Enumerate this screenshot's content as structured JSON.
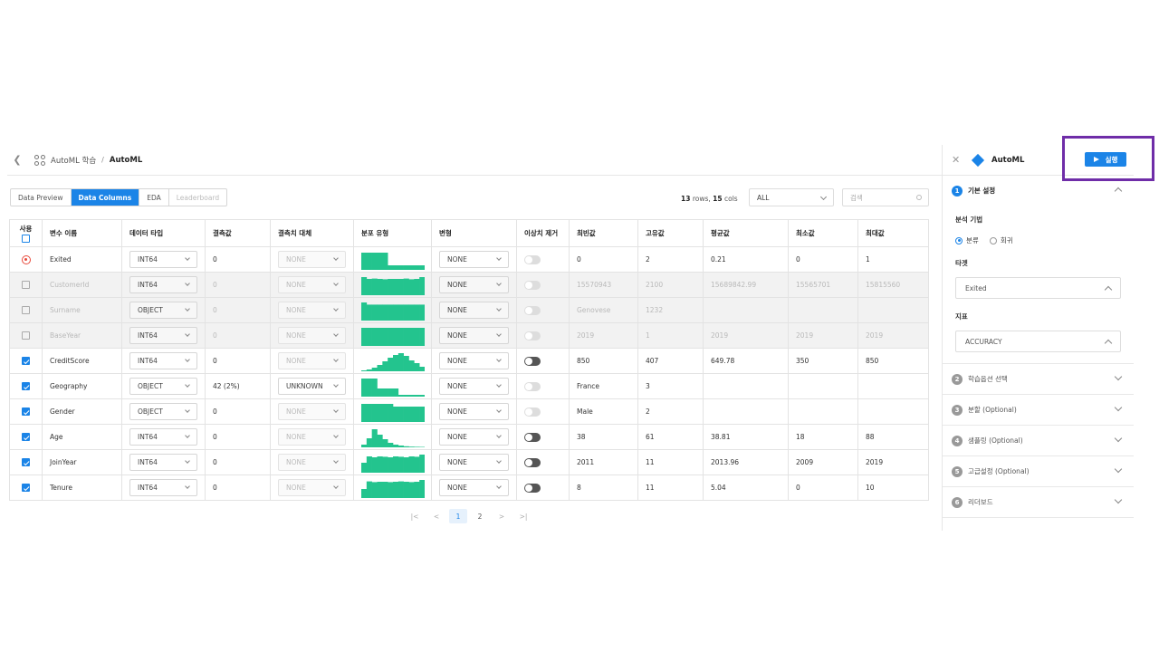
{
  "header": {
    "crumb1": "AutoML 학습",
    "sep": "/",
    "crumb2": "AutoML"
  },
  "tabs": [
    "Data Preview",
    "Data Columns",
    "EDA",
    "Leaderboard"
  ],
  "toolbar": {
    "rows": "13",
    "rows_label": "rows,",
    "cols": "15",
    "cols_label": "cols",
    "filter_value": "ALL",
    "search_placeholder": "검색"
  },
  "table": {
    "headers": [
      "사용",
      "변수 이름",
      "데이터 타입",
      "결측값",
      "결측치 대체",
      "분포 유형",
      "변형",
      "이상치 제거",
      "최빈값",
      "고유값",
      "평균값",
      "최소값",
      "최대값"
    ],
    "rows": [
      {
        "use": "target",
        "name": "Exited",
        "type": "INT64",
        "missing": "0",
        "impute": "NONE",
        "hist": [
          0.95,
          0.95,
          0.95,
          0.95,
          0.95,
          0.25,
          0.25,
          0.25,
          0.25,
          0.25,
          0.25,
          0.25
        ],
        "transform": "NONE",
        "outlier": "off",
        "mode": "0",
        "unique": "2",
        "mean": "0.21",
        "min": "0",
        "max": "1",
        "dim": false
      },
      {
        "use": "unchecked",
        "name": "CustomerId",
        "type": "INT64",
        "missing": "0",
        "impute": "NONE",
        "hist": [
          1,
          0.9,
          0.92,
          0.9,
          0.88,
          0.9,
          0.9,
          0.9,
          0.92,
          0.88,
          0.9,
          1
        ],
        "transform": "NONE",
        "outlier": "off",
        "mode": "15570943",
        "unique": "2100",
        "mean": "15689842.99",
        "min": "15565701",
        "max": "15815560",
        "dim": true
      },
      {
        "use": "unchecked",
        "name": "Surname",
        "type": "OBJECT",
        "missing": "0",
        "impute": "NONE",
        "hist": [
          1,
          0.88,
          0.88,
          0.88,
          0.88,
          0.88,
          0.88,
          0.88,
          0.88,
          0.88,
          0.88,
          0.88
        ],
        "transform": "NONE",
        "outlier": "dis",
        "mode": "Genovese",
        "unique": "1232",
        "mean": "",
        "min": "",
        "max": "",
        "dim": true
      },
      {
        "use": "unchecked",
        "name": "BaseYear",
        "type": "INT64",
        "missing": "0",
        "impute": "NONE",
        "hist": [
          1,
          1,
          1,
          1,
          1,
          1,
          1,
          1,
          1,
          1,
          1,
          1
        ],
        "transform": "NONE",
        "outlier": "dis",
        "mode": "2019",
        "unique": "1",
        "mean": "2019",
        "min": "2019",
        "max": "2019",
        "dim": true
      },
      {
        "use": "checked",
        "name": "CreditScore",
        "type": "INT64",
        "missing": "0",
        "impute": "NONE",
        "hist": [
          0.05,
          0.1,
          0.2,
          0.35,
          0.55,
          0.75,
          0.9,
          1,
          0.85,
          0.6,
          0.45,
          0.25
        ],
        "transform": "NONE",
        "outlier": "on",
        "mode": "850",
        "unique": "407",
        "mean": "649.78",
        "min": "350",
        "max": "850",
        "dim": false
      },
      {
        "use": "checked",
        "name": "Geography",
        "type": "OBJECT",
        "missing": "42 (2%)",
        "impute": "UNKNOWN",
        "hist": [
          1,
          1,
          1,
          0.45,
          0.45,
          0.45,
          0.45,
          0.1,
          0.1,
          0.1,
          0.1,
          0.1
        ],
        "transform": "NONE",
        "outlier": "dis",
        "mode": "France",
        "unique": "3",
        "mean": "",
        "min": "",
        "max": "",
        "dim": false
      },
      {
        "use": "checked",
        "name": "Gender",
        "type": "OBJECT",
        "missing": "0",
        "impute": "NONE",
        "hist": [
          1,
          1,
          1,
          1,
          1,
          1,
          0.85,
          0.85,
          0.85,
          0.85,
          0.85,
          0.85
        ],
        "transform": "NONE",
        "outlier": "dis",
        "mode": "Male",
        "unique": "2",
        "mean": "",
        "min": "",
        "max": "",
        "dim": false
      },
      {
        "use": "checked",
        "name": "Age",
        "type": "INT64",
        "missing": "0",
        "impute": "NONE",
        "hist": [
          0.15,
          0.5,
          1,
          0.7,
          0.45,
          0.25,
          0.15,
          0.1,
          0.06,
          0.04,
          0.03,
          0.02
        ],
        "transform": "NONE",
        "outlier": "on",
        "mode": "38",
        "unique": "61",
        "mean": "38.81",
        "min": "18",
        "max": "88",
        "dim": false
      },
      {
        "use": "checked",
        "name": "JoinYear",
        "type": "INT64",
        "missing": "0",
        "impute": "NONE",
        "hist": [
          0.55,
          0.9,
          0.85,
          0.9,
          0.88,
          0.85,
          0.9,
          0.88,
          0.85,
          0.9,
          0.88,
          1
        ],
        "transform": "NONE",
        "outlier": "on",
        "mode": "2011",
        "unique": "11",
        "mean": "2013.96",
        "min": "2009",
        "max": "2019",
        "dim": false
      },
      {
        "use": "checked",
        "name": "Tenure",
        "type": "INT64",
        "missing": "0",
        "impute": "NONE",
        "hist": [
          0.5,
          0.92,
          0.88,
          0.9,
          0.9,
          0.88,
          0.9,
          0.92,
          0.9,
          0.88,
          0.9,
          1
        ],
        "transform": "NONE",
        "outlier": "on",
        "mode": "8",
        "unique": "11",
        "mean": "5.04",
        "min": "0",
        "max": "10",
        "dim": false
      }
    ]
  },
  "pager": {
    "first": "|<",
    "prev": "<",
    "pages": [
      "1",
      "2"
    ],
    "next": ">",
    "last": ">|",
    "current": "1"
  },
  "right_panel": {
    "title": "AutoML",
    "run_label": "실행",
    "step1": {
      "num": "1",
      "title": "기본 설정",
      "method_label": "분석 기법",
      "opt1": "분류",
      "opt2": "회귀",
      "target_label": "타겟",
      "target_value": "Exited",
      "metric_label": "지표",
      "metric_value": "ACCURACY"
    },
    "steps": [
      {
        "num": "2",
        "title": "학습옵션 선택"
      },
      {
        "num": "3",
        "title": "분할 (Optional)"
      },
      {
        "num": "4",
        "title": "샘플링 (Optional)"
      },
      {
        "num": "5",
        "title": "고급설정 (Optional)"
      },
      {
        "num": "6",
        "title": "리더보드"
      }
    ]
  },
  "colors": {
    "accent": "#1b84e7",
    "hist": "#23c48e",
    "highlight": "#6f2da8",
    "target": "#e84a3c"
  }
}
